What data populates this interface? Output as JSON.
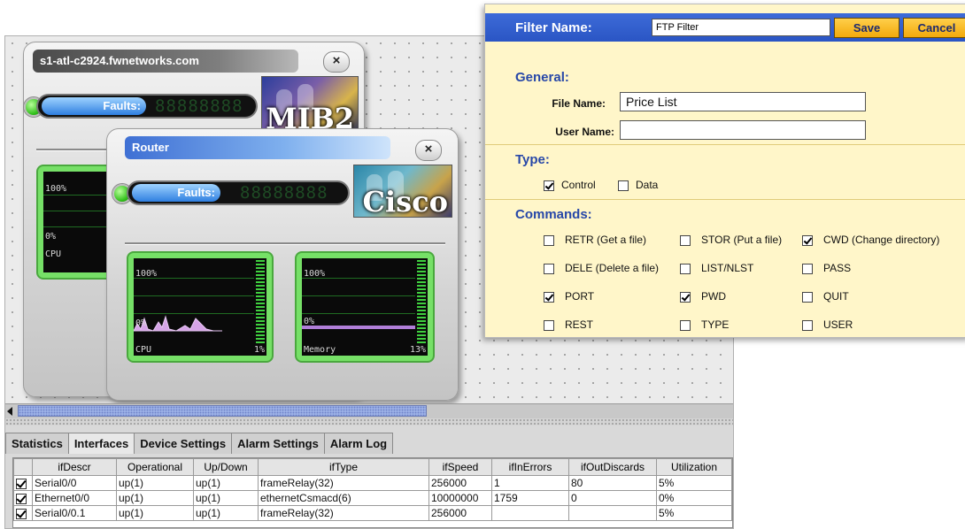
{
  "monitor": {
    "device1": {
      "title": "s1-atl-c2924.fwnetworks.com",
      "close": "×",
      "faults_label": "Faults:",
      "faults_value": "88888888",
      "logo_text": "MIB2",
      "gauge": {
        "top_label": "100%",
        "zero_label": "0%",
        "name": "CPU"
      }
    },
    "device2": {
      "title": "Router",
      "close": "×",
      "faults_label": "Faults:",
      "faults_value": "88888888",
      "logo_text": "Cisco",
      "cpu_gauge": {
        "top_label": "100%",
        "zero_label": "0%",
        "name": "CPU",
        "value": "1%",
        "level": 0.01
      },
      "mem_gauge": {
        "top_label": "100%",
        "zero_label": "0%",
        "name": "Memory",
        "value": "13%",
        "level": 0.13
      }
    },
    "tabs": [
      "Statistics",
      "Interfaces",
      "Device Settings",
      "Alarm Settings",
      "Alarm Log"
    ],
    "active_tab": "Interfaces",
    "table": {
      "columns": [
        "",
        "ifDescr",
        "Operational",
        "Up/Down",
        "ifType",
        "ifSpeed",
        "ifInErrors",
        "ifOutDiscards",
        "Utilization"
      ],
      "rows": [
        {
          "checked": true,
          "cells": [
            "Serial0/0",
            "up(1)",
            "up(1)",
            "frameRelay(32)",
            "256000",
            "1",
            "80",
            "5%"
          ]
        },
        {
          "checked": true,
          "cells": [
            "Ethernet0/0",
            "up(1)",
            "up(1)",
            "ethernetCsmacd(6)",
            "10000000",
            "1759",
            "0",
            "0%"
          ]
        },
        {
          "checked": true,
          "cells": [
            "Serial0/0.1",
            "up(1)",
            "up(1)",
            "frameRelay(32)",
            "256000",
            "",
            "",
            "5%"
          ]
        }
      ]
    }
  },
  "filter": {
    "name_label": "Filter Name:",
    "name_value": "FTP Filter",
    "save": "Save",
    "cancel": "Cancel",
    "general": {
      "title": "General:",
      "file_name_label": "File Name:",
      "file_name_value": "Price List",
      "user_name_label": "User Name:",
      "user_name_value": ""
    },
    "type": {
      "title": "Type:",
      "options": [
        {
          "label": "Control",
          "checked": true
        },
        {
          "label": "Data",
          "checked": false
        }
      ]
    },
    "commands": {
      "title": "Commands:",
      "items": [
        {
          "label": "RETR (Get a file)",
          "checked": false
        },
        {
          "label": "STOR (Put a file)",
          "checked": false
        },
        {
          "label": "CWD (Change directory)",
          "checked": true
        },
        {
          "label": "DELE (Delete a file)",
          "checked": false
        },
        {
          "label": "LIST/NLST",
          "checked": false
        },
        {
          "label": "PASS",
          "checked": false
        },
        {
          "label": "PORT",
          "checked": true
        },
        {
          "label": "PWD",
          "checked": true
        },
        {
          "label": "QUIT",
          "checked": false
        },
        {
          "label": "REST",
          "checked": false
        },
        {
          "label": "TYPE",
          "checked": false
        },
        {
          "label": "USER",
          "checked": false
        }
      ]
    }
  },
  "colors": {
    "filter_header": "#2a55c4",
    "filter_background": "#fff6c9",
    "section_title": "#2848a8",
    "button": "#f2a90c",
    "gauge": "#76e067",
    "status_led": "#2fbf19"
  }
}
